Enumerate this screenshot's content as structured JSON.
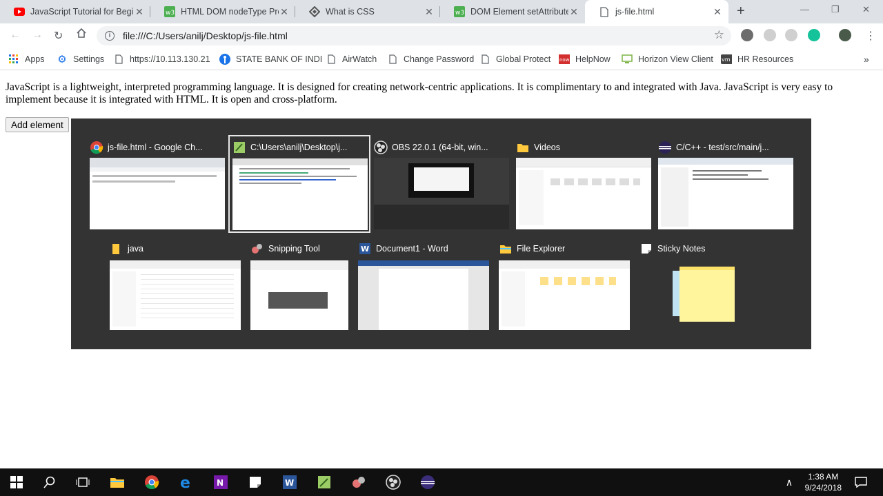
{
  "browser": {
    "tabs": [
      {
        "title": "JavaScript Tutorial for Begi",
        "icon": "youtube-icon"
      },
      {
        "title": "HTML DOM nodeType Prop",
        "icon": "w3schools-icon"
      },
      {
        "title": "What is CSS",
        "icon": "css-site-icon"
      },
      {
        "title": "DOM Element setAttribute",
        "icon": "w3schools-icon"
      },
      {
        "title": "js-file.html",
        "icon": "page-icon"
      }
    ],
    "close_glyph": "✕",
    "new_tab_glyph": "+",
    "url": "file:///C:/Users/anilj/Desktop/js-file.html",
    "bookmarks": [
      {
        "label": "Apps",
        "icon": "apps-grid-icon"
      },
      {
        "label": "Settings",
        "icon": "gear-icon"
      },
      {
        "label": "https://10.113.130.21",
        "icon": "page-icon"
      },
      {
        "label": "STATE BANK OF INDI",
        "icon": "sbi-icon"
      },
      {
        "label": "AirWatch",
        "icon": "page-icon"
      },
      {
        "label": "Change Password",
        "icon": "page-icon"
      },
      {
        "label": "Global Protect",
        "icon": "page-icon"
      },
      {
        "label": "HelpNow",
        "icon": "now-icon"
      },
      {
        "label": "Horizon View Client",
        "icon": "horizon-icon"
      },
      {
        "label": "HR Resources",
        "icon": "vm-icon"
      }
    ],
    "bookmarks_overflow": "»"
  },
  "page": {
    "paragraph": "JavaScript is a lightweight, interpreted programming language. It is designed for creating network-centric applications. It is complimentary to and integrated with Java. JavaScript is very easy to implement because it is integrated with HTML. It is open and cross-platform.",
    "add_button": "Add element"
  },
  "task_switcher": {
    "row1": [
      {
        "title": "js-file.html - Google Ch...",
        "icon": "chrome-icon"
      },
      {
        "title": "C:\\Users\\anilj\\Desktop\\j...",
        "icon": "notepad-plus-icon",
        "selected": true
      },
      {
        "title": "OBS 22.0.1 (64-bit, win...",
        "icon": "obs-icon"
      },
      {
        "title": "Videos",
        "icon": "folder-icon"
      },
      {
        "title": "C/C++ - test/src/main/j...",
        "icon": "eclipse-icon"
      }
    ],
    "row2": [
      {
        "title": "java",
        "icon": "folder-icon"
      },
      {
        "title": "Snipping Tool",
        "icon": "snipping-tool-icon"
      },
      {
        "title": "Document1 - Word",
        "icon": "word-icon"
      },
      {
        "title": "File Explorer",
        "icon": "file-explorer-icon"
      },
      {
        "title": "Sticky Notes",
        "icon": "sticky-notes-icon"
      }
    ]
  },
  "taskbar": {
    "time": "1:38 AM",
    "date": "9/24/2018"
  }
}
